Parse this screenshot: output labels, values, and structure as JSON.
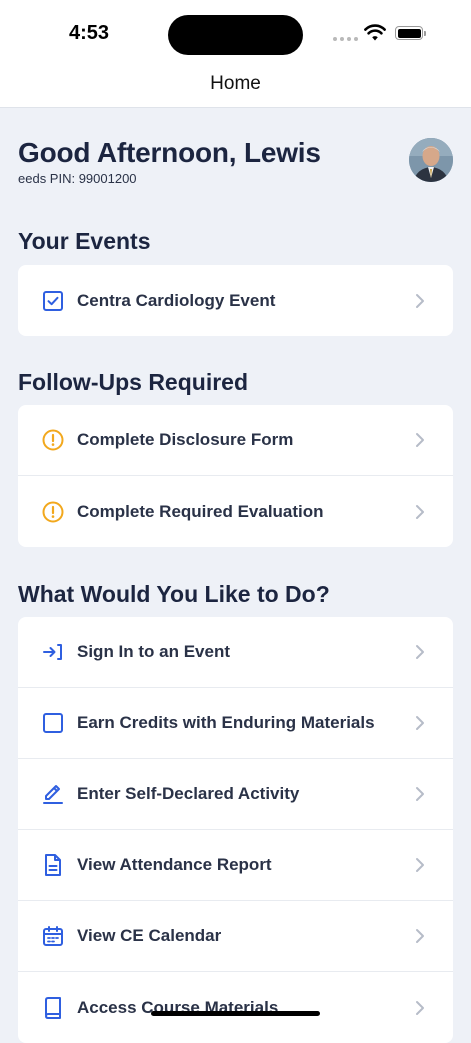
{
  "status_bar": {
    "time": "4:53"
  },
  "nav": {
    "title": "Home"
  },
  "header": {
    "greeting": "Good Afternoon, Lewis",
    "pin": "eeds PIN: 99001200"
  },
  "events": {
    "title": "Your Events",
    "items": [
      {
        "label": "Centra Cardiology Event",
        "icon": "checkbox-checked-icon"
      }
    ]
  },
  "followups": {
    "title": "Follow-Ups Required",
    "items": [
      {
        "label": "Complete Disclosure Form",
        "icon": "warning-circle-icon"
      },
      {
        "label": "Complete Required Evaluation",
        "icon": "warning-circle-icon"
      }
    ]
  },
  "actions": {
    "title": "What Would You Like to Do?",
    "items": [
      {
        "label": "Sign In to an Event",
        "icon": "sign-in-icon"
      },
      {
        "label": "Earn Credits with Enduring Materials",
        "icon": "square-icon"
      },
      {
        "label": "Enter Self-Declared Activity",
        "icon": "pencil-icon"
      },
      {
        "label": "View Attendance Report",
        "icon": "document-icon"
      },
      {
        "label": "View CE Calendar",
        "icon": "calendar-icon"
      },
      {
        "label": "Access Course Materials",
        "icon": "book-icon"
      }
    ]
  },
  "colors": {
    "accent": "#2f5fe0",
    "warning": "#f2a81d",
    "background": "#eef1f7",
    "text": "#1c2540"
  }
}
